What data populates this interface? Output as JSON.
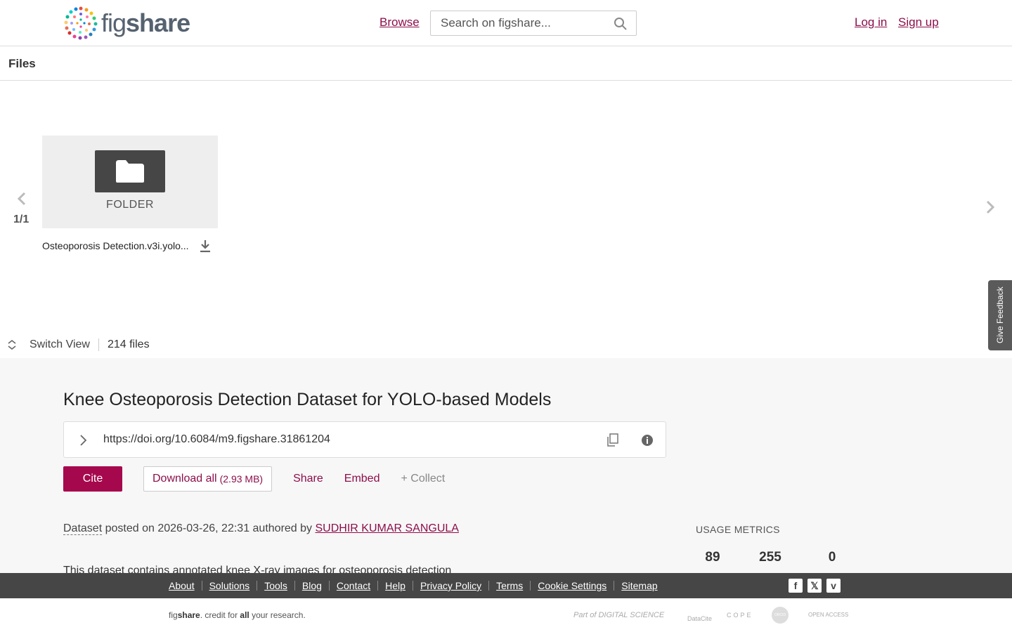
{
  "header": {
    "logo_text_fig": "fig",
    "logo_text_share": "share",
    "browse": "Browse",
    "search_placeholder": "Search on figshare...",
    "login": "Log in",
    "signup": "Sign up"
  },
  "files": {
    "title": "Files",
    "page_indicator": "1/1",
    "items": [
      {
        "type_label": "FOLDER",
        "name": "Osteoporosis Detection.v3i.yolo..."
      }
    ],
    "switch_view": "Switch View",
    "count": "214 files"
  },
  "feedback": "Give Feedback",
  "dataset": {
    "title": "Knee Osteoporosis Detection Dataset for YOLO-based Models",
    "doi": "https://doi.org/10.6084/m9.figshare.31861204",
    "actions": {
      "cite": "Cite",
      "download_all": "Download all",
      "download_size": "(2.93 MB)",
      "share": "Share",
      "embed": "Embed",
      "collect": "+ Collect"
    },
    "type": "Dataset",
    "posted_text": " posted on 2026-03-26, 22:31 authored by ",
    "author": "SUDHIR KUMAR SANGULA",
    "description": "This dataset contains annotated knee X-ray images for osteoporosis detection",
    "usage_metrics": {
      "title": "USAGE METRICS",
      "values": [
        "89",
        "255",
        "0"
      ]
    }
  },
  "footer": {
    "links": [
      "About",
      "Solutions",
      "Tools",
      "Blog",
      "Contact",
      "Help",
      "Privacy Policy",
      "Terms",
      "Cookie Settings",
      "Sitemap"
    ],
    "social": [
      "facebook-icon",
      "x-icon",
      "vimeo-icon"
    ],
    "tagline_fig": "fig",
    "tagline_share": "share",
    "tagline_mid": ". credit for ",
    "tagline_all": "all",
    "tagline_end": " your research.",
    "partners": [
      "Part of DIGITAL SCIENCE",
      "DataCite",
      "COPE",
      "ORCID",
      "OPEN ACCESS"
    ]
  },
  "colors": {
    "brand": "#a6084d",
    "link": "#8c0e4b",
    "footer_bg": "#464646"
  }
}
